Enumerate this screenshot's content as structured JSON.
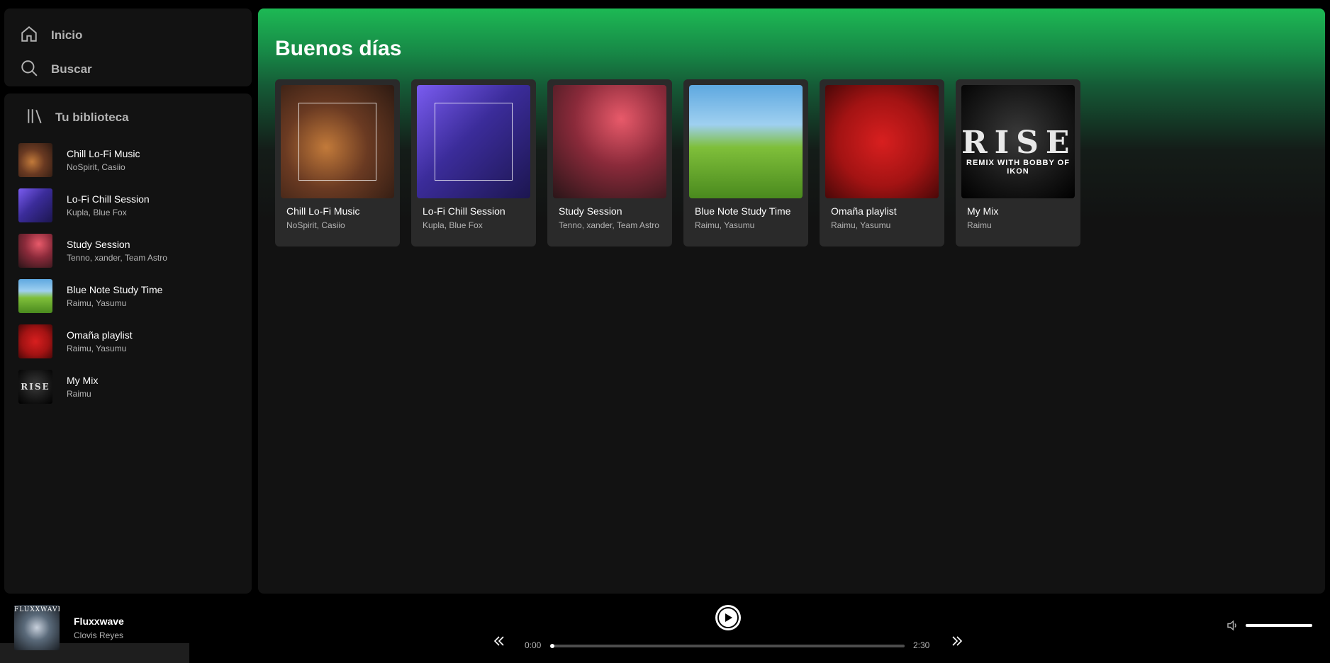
{
  "nav": {
    "home_label": "Inicio",
    "search_label": "Buscar"
  },
  "library": {
    "title": "Tu biblioteca",
    "items": [
      {
        "title": "Chill Lo-Fi Music",
        "subtitle": "NoSpirit, Casiio"
      },
      {
        "title": "Lo-Fi Chill Session",
        "subtitle": "Kupla, Blue Fox"
      },
      {
        "title": "Study Session",
        "subtitle": "Tenno, xander, Team Astro"
      },
      {
        "title": "Blue Note Study Time",
        "subtitle": "Raimu, Yasumu"
      },
      {
        "title": "Omaña playlist",
        "subtitle": "Raimu, Yasumu"
      },
      {
        "title": "My Mix",
        "subtitle": "Raimu"
      }
    ]
  },
  "main": {
    "greeting": "Buenos días",
    "cards": [
      {
        "title": "Chill Lo-Fi Music",
        "subtitle": "NoSpirit, Casiio"
      },
      {
        "title": "Lo-Fi Chill Session",
        "subtitle": "Kupla, Blue Fox"
      },
      {
        "title": "Study Session",
        "subtitle": "Tenno, xander, Team Astro"
      },
      {
        "title": "Blue Note Study Time",
        "subtitle": "Raimu, Yasumu"
      },
      {
        "title": "Omaña playlist",
        "subtitle": "Raimu, Yasumu"
      },
      {
        "title": "My Mix",
        "subtitle": "Raimu",
        "cover_text": "RISE",
        "cover_caption": "REMIX WITH BOBBY OF IKON"
      }
    ]
  },
  "player": {
    "track_title": "Fluxxwave",
    "track_artist": "Clovis Reyes",
    "cover_text": "FLUXXWAVE",
    "current_time": "0:00",
    "total_time": "2:30",
    "progress": 0,
    "volume": 1.0
  },
  "colors": {
    "accent": "#1db954",
    "background": "#121212",
    "card": "#2a2a2a",
    "muted_text": "#b3b3b3"
  },
  "icons": {
    "home": "home-icon",
    "search": "search-icon",
    "library": "library-icon",
    "play": "play-icon",
    "previous": "skip-back-icon",
    "next": "skip-forward-icon",
    "volume": "volume-icon"
  }
}
